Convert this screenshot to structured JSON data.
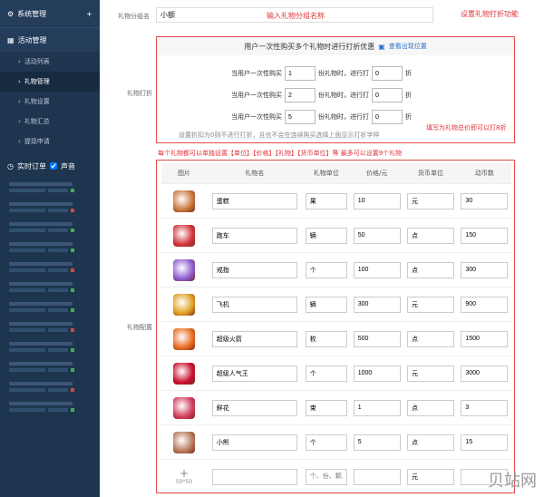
{
  "sidebar": {
    "header": "系统管理",
    "header_plus": "+",
    "section": "活动管理",
    "items": [
      {
        "label": "活动列表",
        "active": false
      },
      {
        "label": "礼物管理",
        "active": true
      },
      {
        "label": "礼物设置",
        "active": false
      },
      {
        "label": "礼物汇总",
        "active": false
      },
      {
        "label": "提现申请",
        "active": false
      }
    ],
    "orders_label": "实时订单",
    "sound_label": "声音",
    "order_count": 12
  },
  "form": {
    "name_label": "礼物分组名",
    "name_value": "小额",
    "deal_label": "礼物打折",
    "gift_label": "礼物配置"
  },
  "notes": {
    "name_note": "输入礼物分组名称",
    "discount_note": "设置礼物打折功能",
    "discount_field_note": "填写为礼物总价即可以打8折",
    "gift_note": "每个礼物都可以单独设置【单位】【价格】【礼物】【货币单位】等  最多可以设置9个礼物"
  },
  "deal": {
    "header": "用户一次性购买多个礼物时进行打折优惠",
    "link": "查看出现位置",
    "rows": [
      {
        "p1": "当用户一次性购买",
        "n": "1",
        "p2": "份礼物时，进行打",
        "v": "0",
        "p3": "折"
      },
      {
        "p1": "当用户一次性购买",
        "n": "2",
        "p2": "份礼物时，进行打",
        "v": "0",
        "p3": "折"
      },
      {
        "p1": "当用户一次性购买",
        "n": "5",
        "p2": "份礼物时，进行打",
        "v": "0",
        "p3": "折"
      }
    ],
    "footer": "设置折扣为0则不进行打折，且也不会在连续购买选择上面显示打折字样"
  },
  "table": {
    "headers": [
      "图片",
      "礼物名",
      "礼物单位",
      "价格/元",
      "货币单位",
      "动币数"
    ],
    "rows": [
      {
        "name": "蛋糕",
        "unit": "果",
        "price": "10",
        "cur": "元",
        "coins": "30",
        "color": "#c9763b"
      },
      {
        "name": "跑车",
        "unit": "辆",
        "price": "50",
        "cur": "点",
        "coins": "150",
        "color": "#d2343b"
      },
      {
        "name": "戒指",
        "unit": "个",
        "price": "100",
        "cur": "点",
        "coins": "300",
        "color": "#8b5ccf"
      },
      {
        "name": "飞机",
        "unit": "辆",
        "price": "300",
        "cur": "元",
        "coins": "900",
        "color": "#e0a020"
      },
      {
        "name": "超级火箭",
        "unit": "枚",
        "price": "500",
        "cur": "点",
        "coins": "1500",
        "color": "#e86b1f"
      },
      {
        "name": "超级人气王",
        "unit": "个",
        "price": "1000",
        "cur": "元",
        "coins": "3000",
        "color": "#c8102e"
      },
      {
        "name": "鲜花",
        "unit": "束",
        "price": "1",
        "cur": "点",
        "coins": "3",
        "color": "#d33d5e"
      },
      {
        "name": "小熊",
        "unit": "个",
        "price": "5",
        "cur": "点",
        "coins": "15",
        "color": "#b7775a"
      }
    ],
    "add_placeholder_unit": "个、份、颗...",
    "add_cur": "元",
    "add_size": "50*50",
    "add_icon": "+"
  },
  "watermark": "贝站网"
}
